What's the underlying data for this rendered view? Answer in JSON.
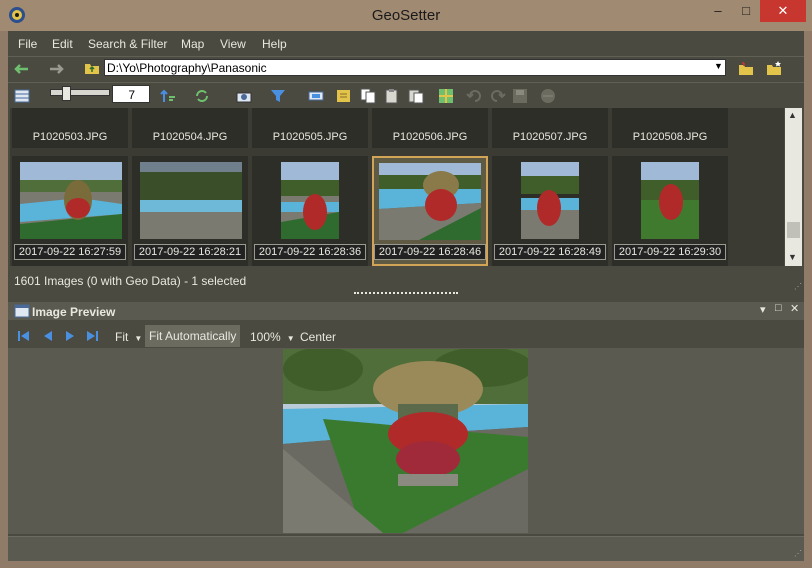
{
  "window": {
    "title": "GeoSetter",
    "minimize": "–",
    "maximize": "□",
    "close": "✕"
  },
  "menu": [
    "File",
    "Edit",
    "Search & Filter",
    "Map",
    "View",
    "Help"
  ],
  "address": {
    "path": "D:\\Yo\\Photography\\Panasonic"
  },
  "toolbar": {
    "thumbnail_size": "7"
  },
  "thumbnails_top": [
    {
      "filename": "P1020503.JPG"
    },
    {
      "filename": "P1020504.JPG"
    },
    {
      "filename": "P1020505.JPG"
    },
    {
      "filename": "P1020506.JPG"
    },
    {
      "filename": "P1020507.JPG"
    },
    {
      "filename": "P1020508.JPG"
    }
  ],
  "thumbnails": [
    {
      "date": "2017-09-22 16:27:59",
      "selected": false
    },
    {
      "date": "2017-09-22 16:28:21",
      "selected": false
    },
    {
      "date": "2017-09-22 16:28:36",
      "selected": false
    },
    {
      "date": "2017-09-22 16:28:46",
      "selected": true
    },
    {
      "date": "2017-09-22 16:28:49",
      "selected": false
    },
    {
      "date": "2017-09-22 16:29:30",
      "selected": false
    }
  ],
  "status": "1601 Images (0 with Geo Data) - 1 selected",
  "preview": {
    "title": "Image Preview",
    "fit": "Fit",
    "fit_auto": "Fit Automatically",
    "zoom": "100%",
    "center": "Center",
    "panel_min": "▾",
    "panel_max": "□",
    "panel_close": "✕"
  },
  "colors": {
    "accent_selection": "#d1a458",
    "close_red": "#c7372f",
    "nav_blue": "#4a90e2",
    "back_green": "#6ec06e"
  }
}
